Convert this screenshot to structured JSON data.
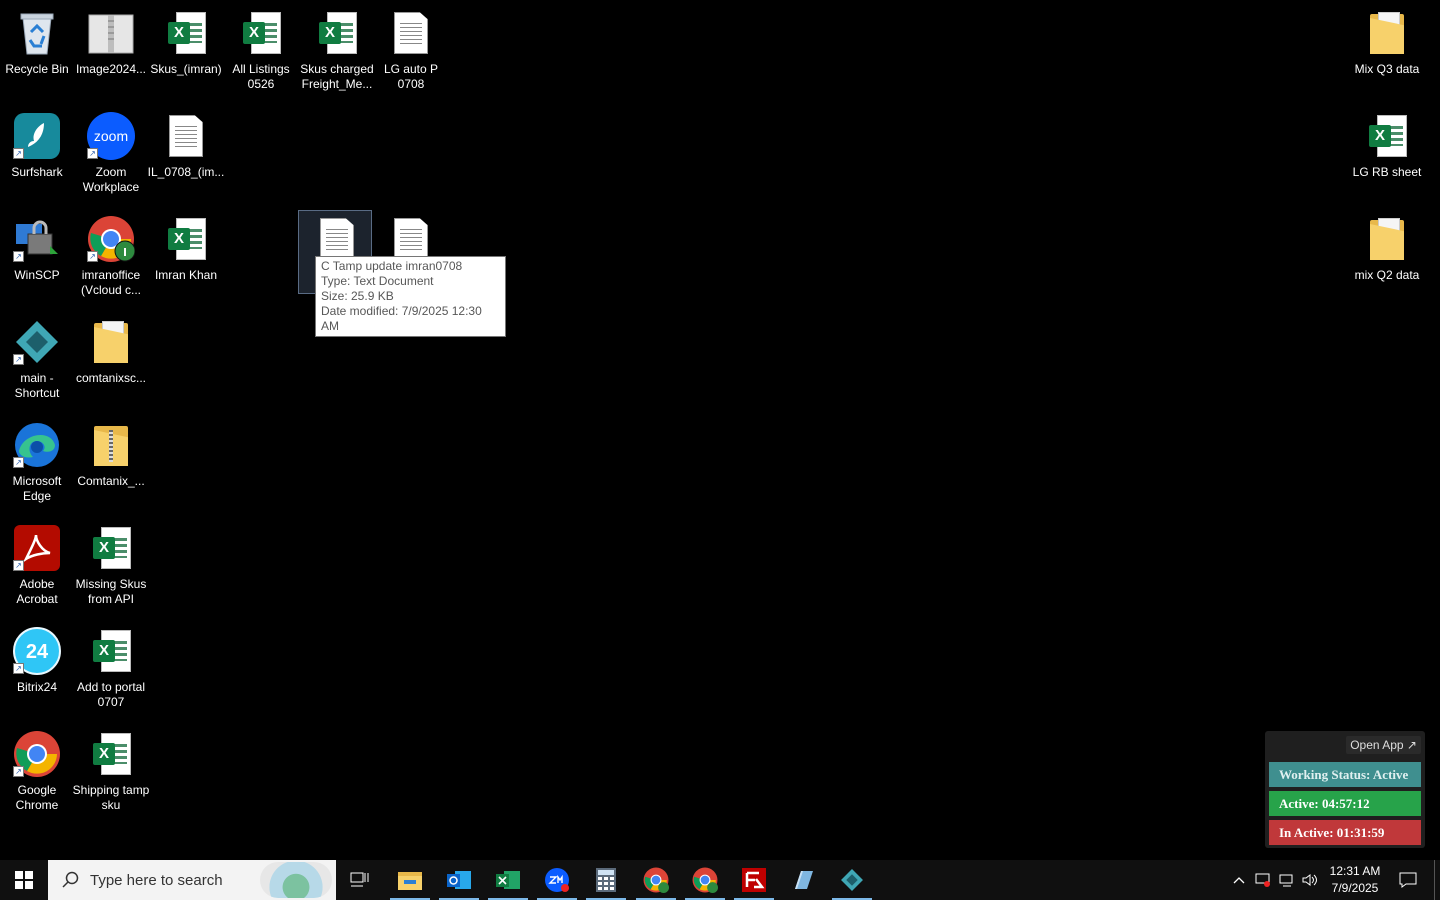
{
  "desktop": {
    "recycle_bin": "Recycle Bin",
    "image2024": "Image2024...",
    "skus_imran": "Skus_(imran)",
    "all_listings": "All Listings 0526",
    "skus_charged": "Skus charged Freight_Me...",
    "lg_auto": "LG auto P 0708",
    "surfshark": "Surfshark",
    "zoom": "Zoom Workplace",
    "zoom_logo": "zoom",
    "il_0708": "IL_0708_(im...",
    "winscp": "WinSCP",
    "imranoffice": "imranoffice (Vcloud c...",
    "imran_khan": "Imran Khan",
    "main_shortcut": "main - Shortcut",
    "comtanixsc": "comtanixsc...",
    "edge": "Microsoft Edge",
    "comtanix_zip": "Comtanix_...",
    "acrobat": "Adobe Acrobat",
    "missing_skus": "Missing Skus from API",
    "bitrix": "Bitrix24",
    "bitrix_logo": "24",
    "add_portal": "Add to portal 0707",
    "chrome": "Google Chrome",
    "shipping": "Shipping tamp sku",
    "mix_q3": "Mix Q3 data",
    "lg_rb": "LG RB sheet",
    "mix_q2": "mix Q2 data"
  },
  "tooltip": {
    "name": "C Tamp update imran0708",
    "type": "Type: Text Document",
    "size": "Size: 25.9 KB",
    "modified": "Date modified: 7/9/2025 12:30 AM"
  },
  "widget": {
    "open_app": "Open App ↗",
    "working_status": "Working Status: Active",
    "active": "Active: 04:57:12",
    "inactive": "In Active: 01:31:59"
  },
  "taskbar": {
    "search_placeholder": "Type here to search",
    "time": "12:31 AM",
    "date": "7/9/2025"
  },
  "colors": {
    "excel_green": "#107c41",
    "status_teal": "#3f8f8f",
    "status_green": "#27a34a",
    "status_red": "#c0383a"
  }
}
